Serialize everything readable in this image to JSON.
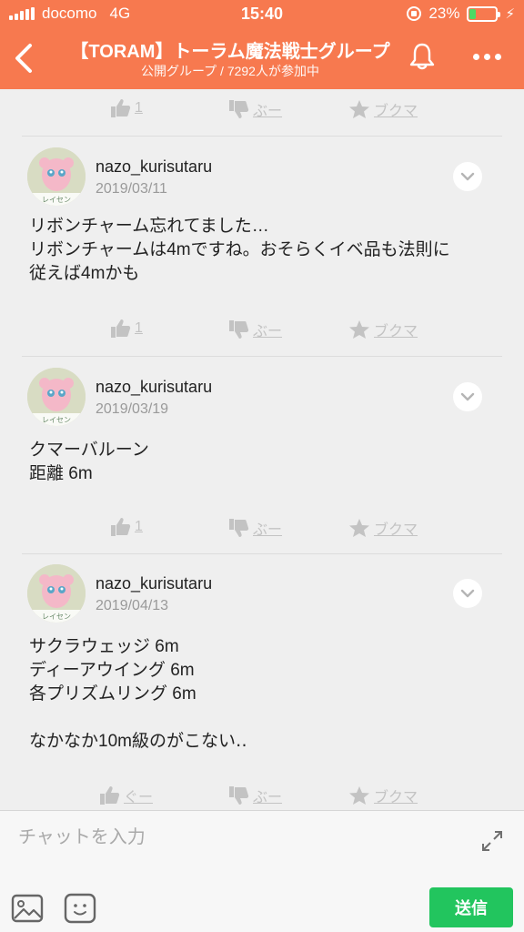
{
  "status_bar": {
    "carrier": "docomo",
    "network": "4G",
    "time": "15:40",
    "battery": "23%",
    "battery_level": 0.23
  },
  "header": {
    "title": "【TORAM】トーラム魔法戦士グループ",
    "subtitle": "公開グループ / 7292人が参加中"
  },
  "reaction_labels": {
    "boo": "ぶー",
    "bookmark": "ブクマ"
  },
  "top_actions": {
    "good": "1"
  },
  "posts": [
    {
      "username": "nazo_kurisutaru",
      "date": "2019/03/11",
      "avatar_caption": "レイセン",
      "body": "リボンチャーム忘れてました…\nリボンチャームは4mですね。おそらくイベ品も法則に\n従えば4mかも",
      "good": "1"
    },
    {
      "username": "nazo_kurisutaru",
      "date": "2019/03/19",
      "avatar_caption": "レイセン",
      "body": "クマーバルーン\n距離 6m",
      "good": "1"
    },
    {
      "username": "nazo_kurisutaru",
      "date": "2019/04/13",
      "avatar_caption": "レイセン",
      "body": "サクラウェッジ 6m\nディーアウイング 6m\n各プリズムリング 6m\n\nなかなか10m級のがこない‥",
      "good": "ぐー"
    }
  ],
  "composer": {
    "placeholder": "チャットを入力",
    "send_label": "送信"
  },
  "colors": {
    "header_bg": "#f7794f",
    "send_bg": "#22c55e",
    "reaction": "#c3c3c3",
    "battery_fill": "#4cd964"
  },
  "icons": [
    "back-chevron-icon",
    "bell-icon",
    "more-dots-icon",
    "thumbs-up-icon",
    "thumbs-down-icon",
    "star-icon",
    "chevron-down-icon",
    "expand-icon",
    "image-icon",
    "sticker-icon"
  ]
}
